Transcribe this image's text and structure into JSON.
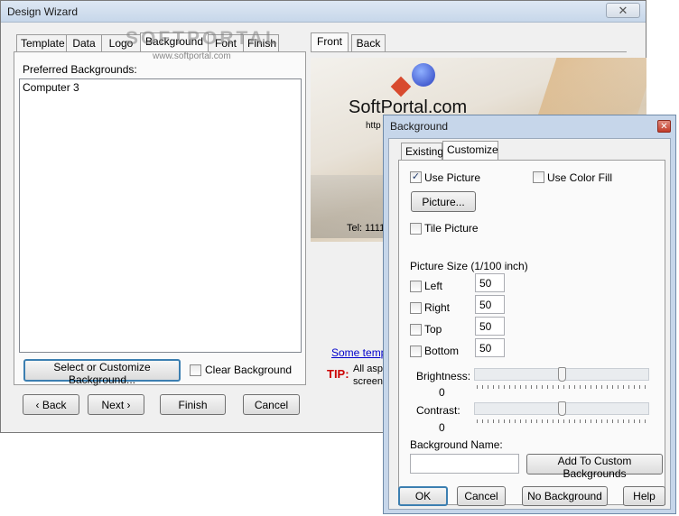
{
  "wizard": {
    "title": "Design Wizard",
    "tabs": [
      "Template",
      "Data",
      "Logo",
      "Background",
      "Font",
      "Finish"
    ],
    "watermark": "SOFTPORTAL",
    "watermark_url": "www.softportal.com",
    "preferred_label": "Preferred Backgrounds:",
    "list_items": [
      "Computer 3"
    ],
    "select_button": "Select or Customize Background...",
    "clear_label": "Clear Background",
    "nav": {
      "back": "Back",
      "next": "Next",
      "finish": "Finish",
      "cancel": "Cancel"
    },
    "preview_tabs": [
      "Front",
      "Back"
    ],
    "preview": {
      "company": "SoftPortal.com",
      "url": "http",
      "tel": "Tel: 1111"
    },
    "templates_link": "Some templ",
    "tip_label": "TIP:",
    "tip_line1": "All asp",
    "tip_line2": "screen"
  },
  "dialog": {
    "title": "Background",
    "tabs": [
      "Existing",
      "Customize"
    ],
    "use_picture": {
      "label": "Use Picture",
      "checked": true
    },
    "use_color_fill": {
      "label": "Use Color Fill",
      "checked": false
    },
    "picture_button": "Picture...",
    "tile_picture": {
      "label": "Tile Picture",
      "checked": false
    },
    "picture_size_label": "Picture Size (1/100 inch)",
    "sizes": [
      {
        "label": "Left",
        "value": "50"
      },
      {
        "label": "Right",
        "value": "50"
      },
      {
        "label": "Top",
        "value": "50"
      },
      {
        "label": "Bottom",
        "value": "50"
      }
    ],
    "brightness": {
      "label": "Brightness:",
      "value": "0",
      "level": 0.5
    },
    "contrast": {
      "label": "Contrast:",
      "value": "0",
      "level": 0.5
    },
    "bg_name_label": "Background Name:",
    "bg_name_value": "",
    "add_custom_button": "Add To Custom Backgrounds",
    "ok": "OK",
    "cancel": "Cancel",
    "no_background": "No Background",
    "help": "Help"
  },
  "colors": {
    "tip": "#cc0000",
    "link": "#0000cc",
    "close": "#c94a3a"
  }
}
